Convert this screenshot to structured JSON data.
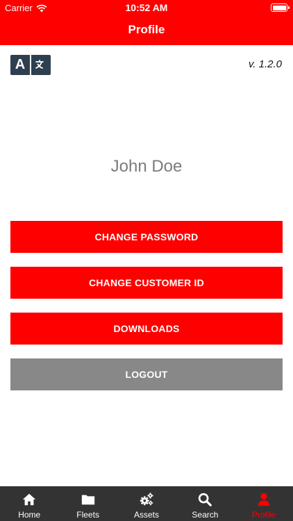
{
  "status_bar": {
    "carrier": "Carrier",
    "time": "10:52 AM"
  },
  "nav": {
    "title": "Profile"
  },
  "language_button": {
    "glyph_left": "A",
    "icon": "translate-icon"
  },
  "version": "v. 1.2.0",
  "user": {
    "name": "John Doe"
  },
  "buttons": {
    "change_password": "CHANGE PASSWORD",
    "change_customer_id": "CHANGE CUSTOMER ID",
    "downloads": "DOWNLOADS",
    "logout": "LOGOUT"
  },
  "tabs": [
    {
      "label": "Home",
      "icon": "home-icon",
      "active": false
    },
    {
      "label": "Fleets",
      "icon": "folder-icon",
      "active": false
    },
    {
      "label": "Assets",
      "icon": "gears-icon",
      "active": false
    },
    {
      "label": "Search",
      "icon": "search-icon",
      "active": false
    },
    {
      "label": "Profile",
      "icon": "user-icon",
      "active": true
    }
  ],
  "colors": {
    "brand_red": "#ff0000",
    "tab_bar": "#333333",
    "logout_grey": "#888888",
    "name_text": "#7c7c7c",
    "lang_icon_bg": "#2e3f4f"
  }
}
